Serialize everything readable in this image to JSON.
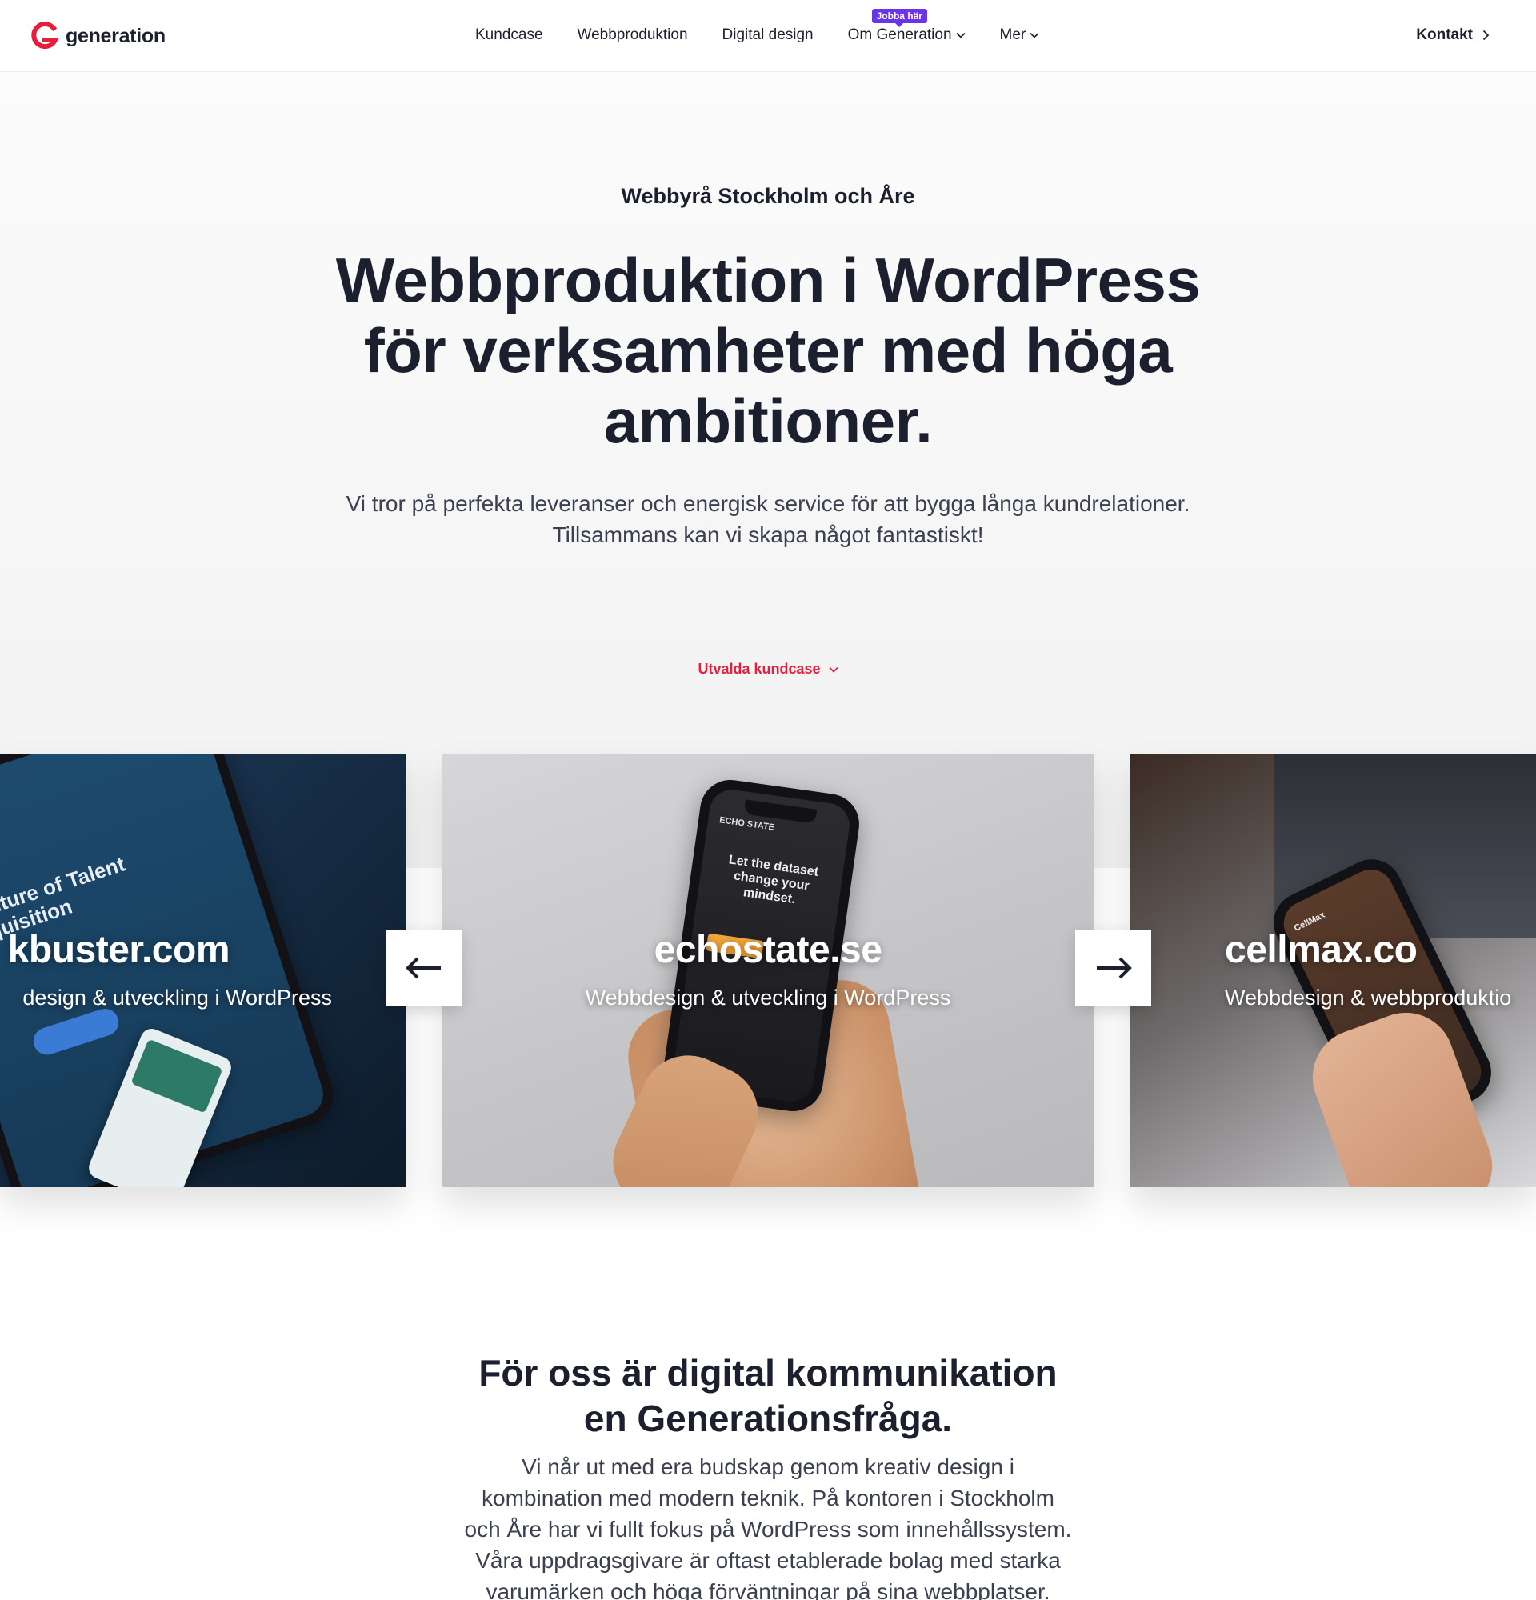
{
  "brand": {
    "name": "generation",
    "accent": "#e61e3c",
    "badge_color": "#6a35e8"
  },
  "nav": {
    "items": [
      {
        "label": "Kundcase"
      },
      {
        "label": "Webbproduktion"
      },
      {
        "label": "Digital design"
      },
      {
        "label": "Om Generation",
        "badge": "Jobba här",
        "has_dropdown": true
      },
      {
        "label": "Mer",
        "has_dropdown": true
      }
    ],
    "contact": "Kontakt"
  },
  "hero": {
    "eyebrow": "Webbyrå Stockholm och Åre",
    "title_lines": [
      "Webbproduktion i WordPress",
      "för verksamheter med höga",
      "ambitioner."
    ],
    "lead_lines": [
      "Vi tror på perfekta leveranser och energisk service för att bygga långa kundrelationer.",
      "Tillsammans kan vi skapa något fantastiskt!"
    ],
    "cases_link": "Utvalda kundcase"
  },
  "carousel": {
    "cards": [
      {
        "title": "kbuster.com",
        "subtitle": "design & utveckling i WordPress",
        "phone_text": "future of Talent quisition"
      },
      {
        "title": "echostate.se",
        "subtitle": "Webbdesign & utveckling i WordPress",
        "phone_brand": "ECHO STATE",
        "phone_text": "Let the dataset change your mindset."
      },
      {
        "title": "cellmax.co",
        "subtitle": "Webbdesign & webbproduktio",
        "phone_brand": "CellMax"
      }
    ]
  },
  "section2": {
    "title_lines": [
      "För oss är digital kommunikation",
      "en Generationsfråga."
    ],
    "text_lines": [
      "Vi når ut med era budskap genom kreativ design i",
      "kombination med modern teknik. På kontoren i Stockholm",
      "och Åre har vi fullt fokus på WordPress som innehållssystem.",
      "Våra uppdragsgivare är oftast etablerade bolag med starka",
      "varumärken och höga förväntningar på sina webbplatser."
    ]
  }
}
